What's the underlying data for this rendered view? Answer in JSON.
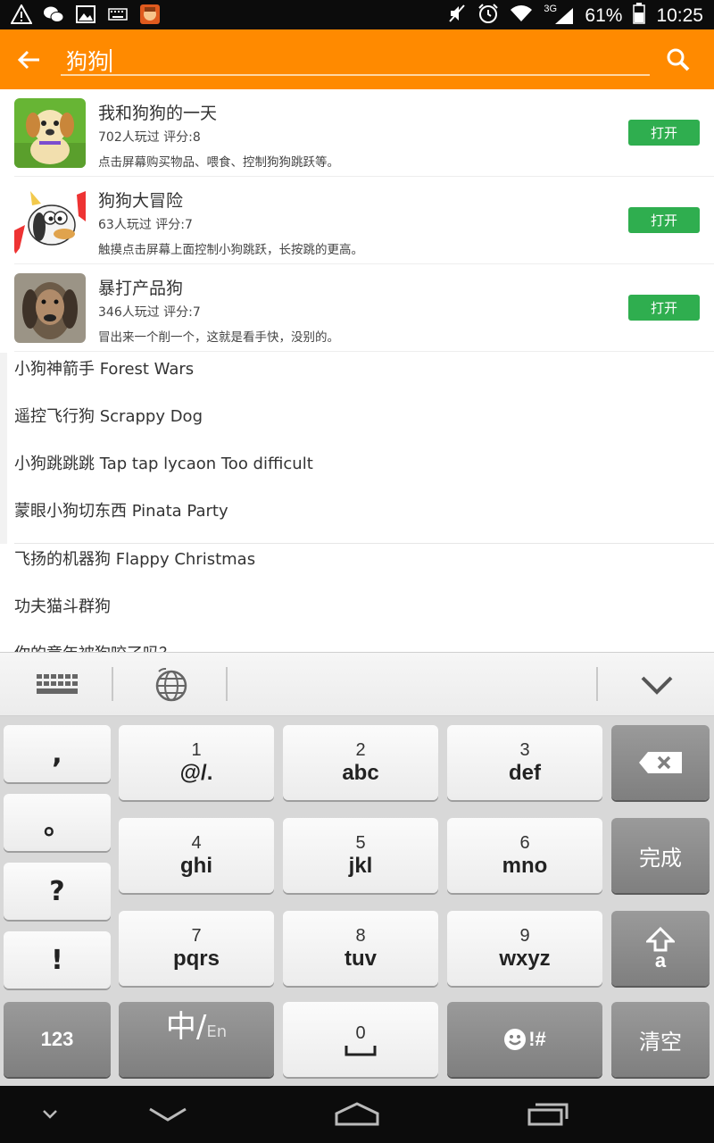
{
  "statusbar": {
    "network": "3G",
    "battery": "61%",
    "time": "10:25",
    "icons": [
      "warning-icon",
      "wechat-icon",
      "image-icon",
      "keyboard-icon",
      "avatar-icon"
    ]
  },
  "search": {
    "query": "狗狗",
    "back_icon": "arrow-left-icon",
    "search_icon": "search-icon"
  },
  "apps": [
    {
      "title": "我和狗狗的一天",
      "meta": "702人玩过  评分:8",
      "desc": "点击屏幕购买物品、喂食、控制狗狗跳跃等。",
      "button": "打开"
    },
    {
      "title": "狗狗大冒险",
      "meta": "63人玩过  评分:7",
      "desc": "触摸点击屏幕上面控制小狗跳跃，长按跳的更高。",
      "button": "打开"
    },
    {
      "title": "暴打产品狗",
      "meta": "346人玩过  评分:7",
      "desc": "冒出来一个削一个，这就是看手快，没别的。",
      "button": "打开"
    }
  ],
  "suggestions": [
    "小狗神箭手 Forest Wars",
    "遥控飞行狗 Scrappy Dog",
    "小狗跳跳跳 Tap tap lycaon Too difficult",
    "蒙眼小狗切东西 Pinata Party",
    "飞扬的机器狗 Flappy Christmas",
    "功夫猫斗群狗",
    "你的童年被狗咬了吗？"
  ],
  "keyboard": {
    "punctuation": [
      ",",
      "。",
      "?",
      "!"
    ],
    "keys": [
      {
        "num": "1",
        "letters": "@/."
      },
      {
        "num": "2",
        "letters": "abc"
      },
      {
        "num": "3",
        "letters": "def"
      },
      {
        "num": "4",
        "letters": "ghi"
      },
      {
        "num": "5",
        "letters": "jkl"
      },
      {
        "num": "6",
        "letters": "mno"
      },
      {
        "num": "7",
        "letters": "pqrs"
      },
      {
        "num": "8",
        "letters": "tuv"
      },
      {
        "num": "9",
        "letters": "wxyz"
      }
    ],
    "done": "完成",
    "shift_letter": "a",
    "num_switch": "123",
    "lang_zh": "中/",
    "lang_en": "En",
    "space_num": "0",
    "emoji_label": "!#",
    "clear": "清空"
  }
}
